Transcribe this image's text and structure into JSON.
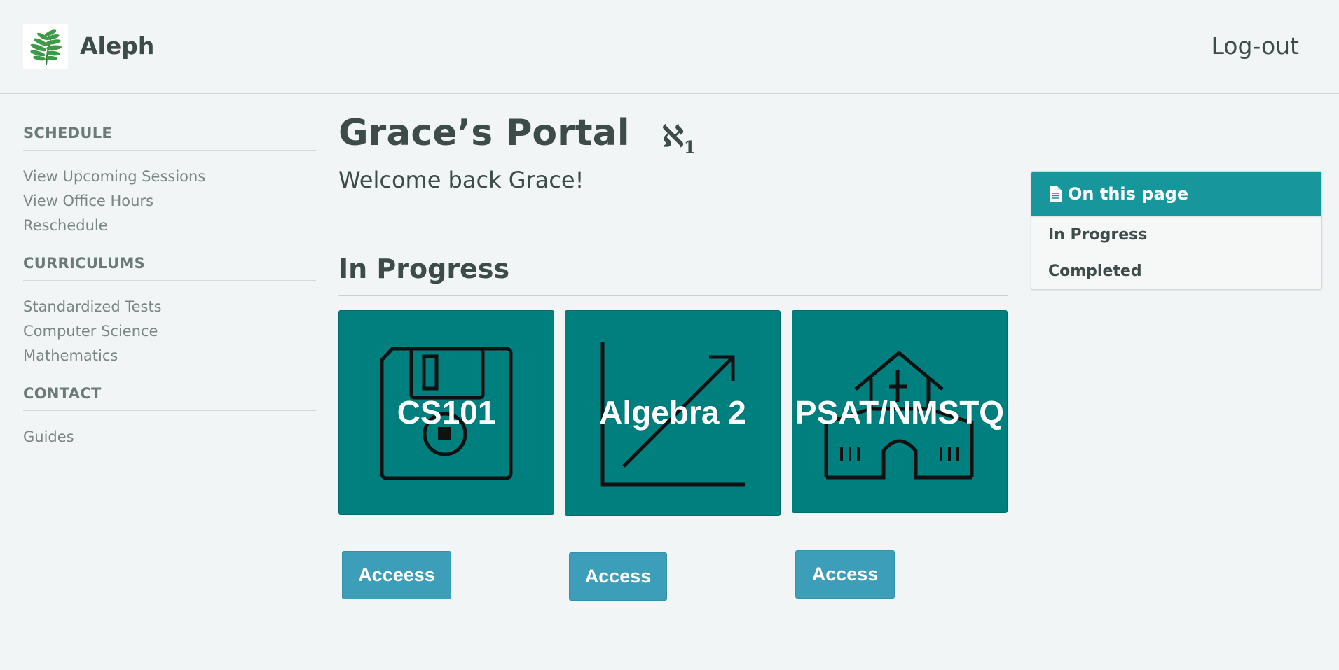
{
  "header": {
    "brand": "Aleph",
    "logout_label": "Log-out",
    "logo_icon": "fern-leaf-icon"
  },
  "sidebar": {
    "groups": [
      {
        "heading": "SCHEDULE",
        "items": [
          "View Upcoming Sessions",
          "View Office Hours",
          "Reschedule"
        ]
      },
      {
        "heading": "CURRICULUMS",
        "items": [
          "Standardized Tests",
          "Computer Science",
          "Mathematics"
        ]
      },
      {
        "heading": "CONTACT",
        "items": [
          "Guides"
        ]
      }
    ]
  },
  "main": {
    "title": "Grace’s Portal",
    "title_mark": "ℵ",
    "title_mark_sub": "1",
    "welcome": "Welcome back Grace!",
    "section_title": "In Progress",
    "cards": [
      {
        "label": "CS101",
        "icon": "floppy-disk-icon",
        "button": "Acceess"
      },
      {
        "label": "Algebra 2",
        "icon": "growth-chart-icon",
        "button": "Access"
      },
      {
        "label": "PSAT/NMSTQ",
        "icon": "school-building-icon",
        "button": "Access"
      }
    ]
  },
  "on_this_page": {
    "heading": "On this page",
    "items": [
      "In Progress",
      "Completed"
    ]
  },
  "colors": {
    "card_bg": "#007f7f",
    "button_bg": "#3d9eba",
    "panel_header": "#17979c",
    "page_bg": "#f1f5f6"
  }
}
